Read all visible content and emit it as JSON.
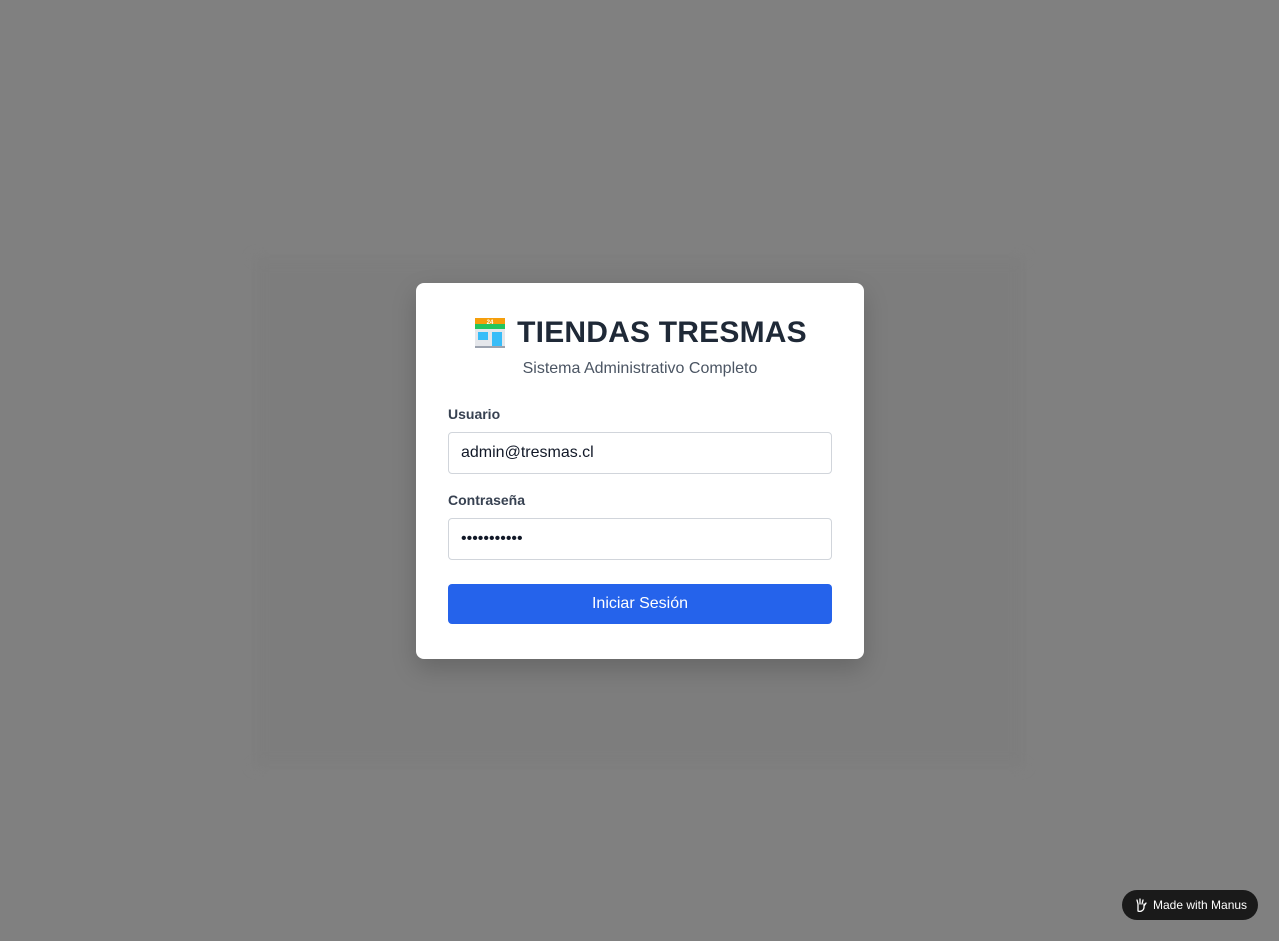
{
  "app": {
    "title": "TIENDAS TRESMAS",
    "subtitle": "Sistema Administrativo Completo",
    "icon": "convenience-store-icon"
  },
  "form": {
    "user_label": "Usuario",
    "user_value": "admin@tresmas.cl",
    "password_label": "Contraseña",
    "password_value": "tresmas2024",
    "submit_label": "Iniciar Sesión"
  },
  "badge": {
    "label": "Made with Manus",
    "icon": "manus-hand-icon"
  },
  "colors": {
    "backdrop": "#808080",
    "primary_button": "#2563eb",
    "title_text": "#1f2937",
    "badge_bg": "#1a1a1a"
  }
}
